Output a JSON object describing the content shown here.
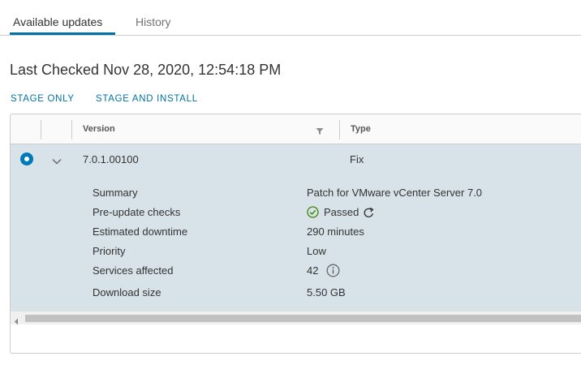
{
  "tabs": [
    {
      "label": "Available updates"
    },
    {
      "label": "History"
    }
  ],
  "last_checked": "Last Checked Nov 28, 2020, 12:54:18 PM",
  "actions": {
    "stage_only": "STAGE ONLY",
    "stage_and_install": "STAGE AND INSTALL"
  },
  "grid": {
    "columns": {
      "version": "Version",
      "type": "Type"
    },
    "row": {
      "version": "7.0.1.00100",
      "type": "Fix",
      "selected": true,
      "expanded": true
    },
    "details": [
      {
        "label": "Summary",
        "value": "Patch for VMware vCenter Server 7.0"
      },
      {
        "label": "Pre-update checks",
        "value": "Passed"
      },
      {
        "label": "Estimated downtime",
        "value": "290 minutes"
      },
      {
        "label": "Priority",
        "value": "Low"
      },
      {
        "label": "Services affected",
        "value": "42"
      },
      {
        "label": "Download size",
        "value": "5.50 GB"
      }
    ]
  },
  "colors": {
    "accent": "#0072a3",
    "selected_row": "#d8e3e9",
    "passed_green": "#3c8500"
  },
  "icons": {
    "filter": "filter-icon",
    "expand": "chevron-down-icon",
    "passed": "check-circle-icon",
    "refresh": "refresh-icon",
    "info": "info-circle-icon",
    "scroll_left": "caret-left-icon"
  }
}
